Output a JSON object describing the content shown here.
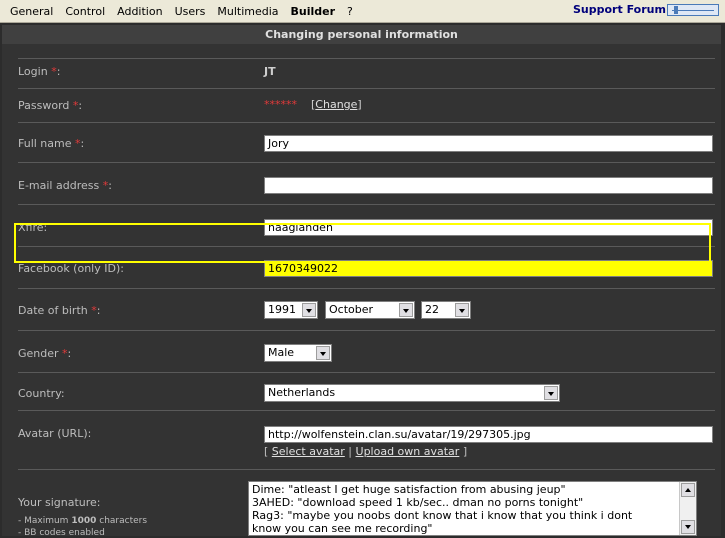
{
  "menu": {
    "items": [
      "General",
      "Control",
      "Addition",
      "Users",
      "Multimedia",
      "Builder",
      "?"
    ],
    "active": "Builder"
  },
  "support_link": "Support Forum",
  "panel_title": "Changing personal information",
  "fields": {
    "login": {
      "label": "Login",
      "req": "*",
      "colon": ":",
      "value": "JT"
    },
    "password": {
      "label": "Password",
      "req": "*",
      "colon": ":",
      "value": "******",
      "change_open": "[",
      "change_link": "Change",
      "change_close": "]"
    },
    "fullname": {
      "label": "Full name",
      "req": "*",
      "colon": ":",
      "value": "Jory"
    },
    "email": {
      "label": "E-mail address",
      "req": "*",
      "colon": ":",
      "value": ""
    },
    "xfire": {
      "label": "Xfire:",
      "value": "haaglanden"
    },
    "facebook": {
      "label": "Facebook (only ID):",
      "value": "1670349022"
    },
    "dob": {
      "label": "Date of birth",
      "req": "*",
      "colon": ":",
      "year": "1991",
      "month": "October",
      "day": "22"
    },
    "gender": {
      "label": "Gender",
      "req": "*",
      "colon": ":",
      "value": "Male"
    },
    "country": {
      "label": "Country:",
      "value": "Netherlands"
    },
    "avatar": {
      "label": "Avatar (URL):",
      "value": "http://wolfenstein.clan.su/avatar/19/297305.jpg",
      "open": "[",
      "select_link": "Select avatar",
      "sep": "|",
      "upload_link": "Upload own avatar",
      "close": "]"
    },
    "signature": {
      "label": "Your signature:",
      "note1_pre": "- Maximum ",
      "note1_num": "1000",
      "note1_post": " characters",
      "note2": "- BB codes enabled",
      "lines": [
        "Dime: \"atleast I get huge satisfaction from abusing jeup\"",
        "3AHED: \"download speed 1 kb/sec.. dman no porns tonight\"",
        "Rag3: \"maybe you noobs dont know that i know that you think i dont",
        "know you can see me recording\""
      ]
    }
  },
  "colors": {
    "highlight": "#ffff00",
    "required": "#e23a3a",
    "panel": "#333333"
  }
}
